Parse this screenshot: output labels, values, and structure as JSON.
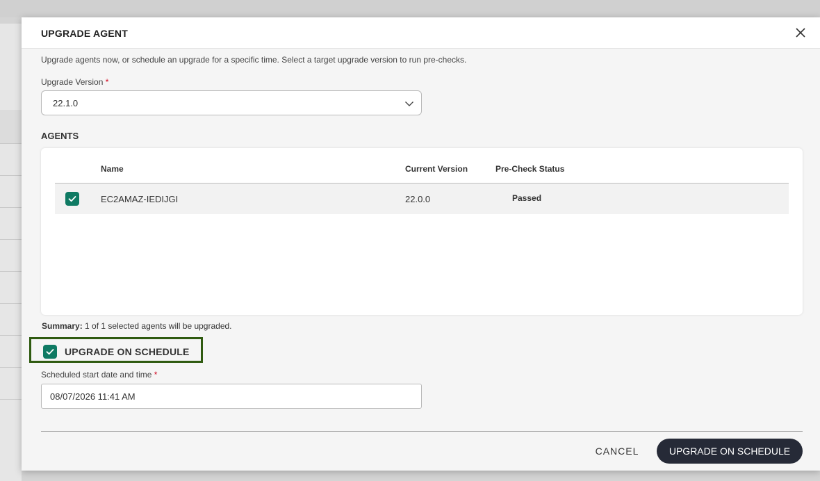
{
  "modal": {
    "title": "UPGRADE AGENT",
    "description": "Upgrade agents now, or schedule an upgrade for a specific time. Select a target upgrade version to run pre-checks."
  },
  "upgrade_version": {
    "label": "Upgrade Version",
    "required_mark": "*",
    "selected_value": "22.1.0"
  },
  "agents": {
    "section_title": "AGENTS",
    "columns": [
      "Name",
      "Current Version",
      "Pre-Check Status"
    ],
    "rows": [
      {
        "name": "EC2AMAZ-IEDIJGI",
        "current_version": "22.0.0",
        "pre_check_status": "Passed",
        "selected": true
      }
    ]
  },
  "summary": {
    "label": "Summary:",
    "text": " 1 of 1 selected agents will be upgraded."
  },
  "schedule": {
    "checkbox_label": "UPGRADE ON SCHEDULE",
    "checked": true,
    "start_label": "Scheduled start date and time",
    "required_mark": "*",
    "start_value": "08/07/2026 11:41 AM"
  },
  "footer": {
    "cancel_label": "CANCEL",
    "submit_label": "UPGRADE ON SCHEDULE"
  },
  "colors": {
    "accent": "#0f7a63",
    "focus_outline": "#2f5a10",
    "primary_button": "#262a37",
    "required": "#d0021b"
  },
  "icons": {
    "close": "close-icon",
    "dropdown": "chevron-down-icon",
    "checkbox": "check-icon"
  }
}
